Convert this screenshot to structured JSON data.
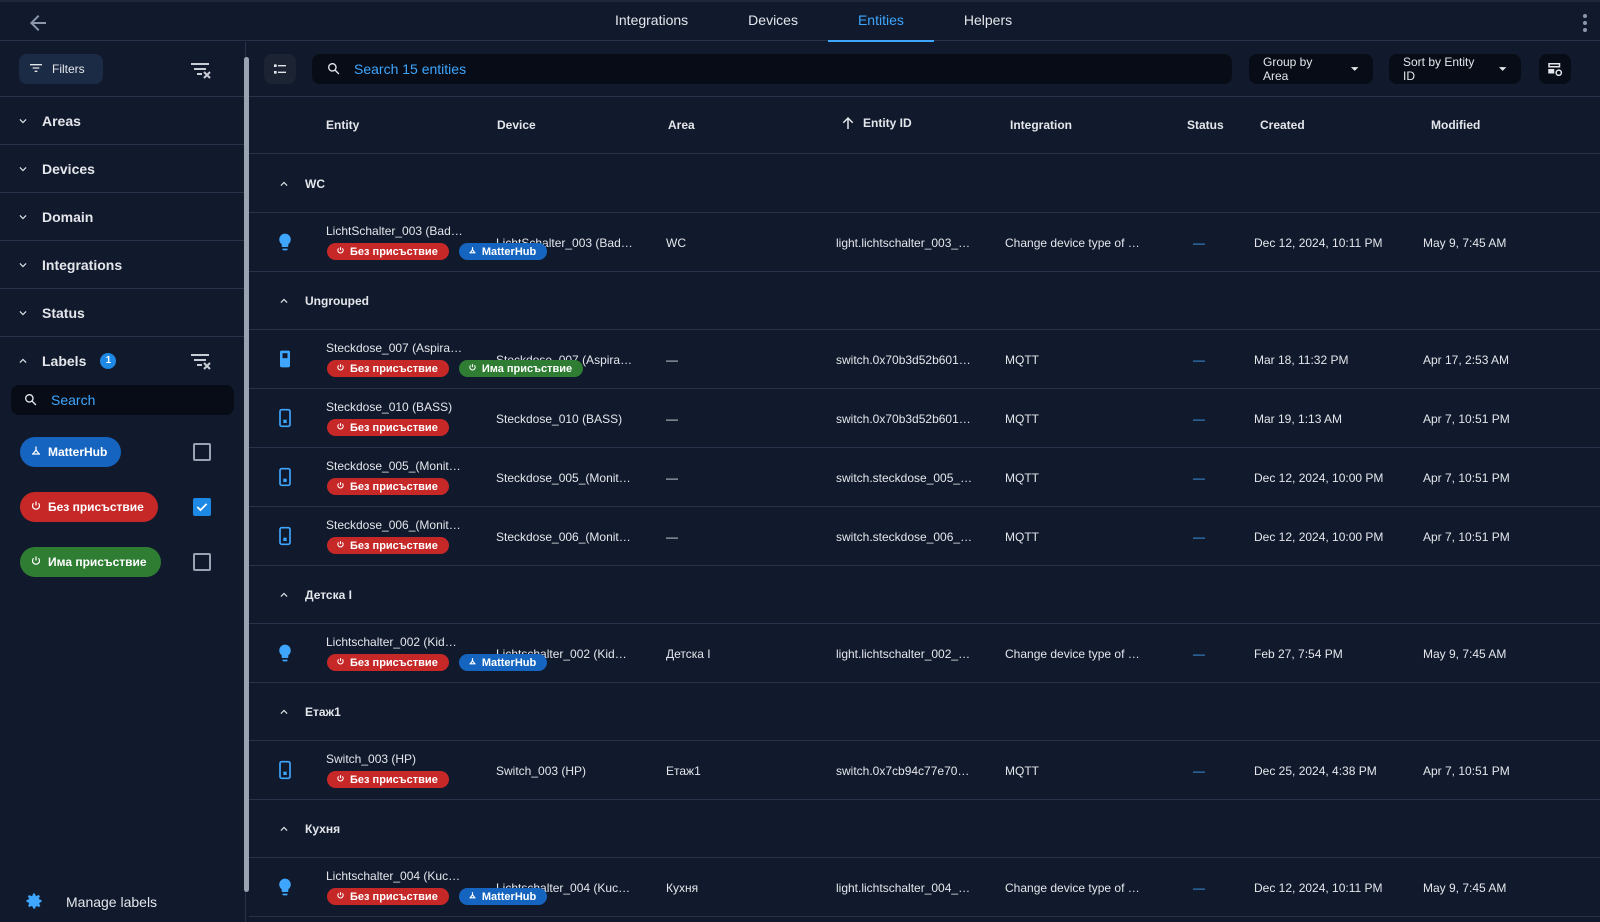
{
  "topbar": {
    "tabs": [
      {
        "label": "Integrations"
      },
      {
        "label": "Devices"
      },
      {
        "label": "Entities",
        "active": true
      },
      {
        "label": "Helpers"
      }
    ]
  },
  "sidebar": {
    "filters_label": "Filters",
    "sections": [
      {
        "label": "Areas"
      },
      {
        "label": "Devices"
      },
      {
        "label": "Domain"
      },
      {
        "label": "Integrations"
      },
      {
        "label": "Status"
      }
    ],
    "labels": {
      "title": "Labels",
      "count": "1",
      "search_placeholder": "Search",
      "items": [
        {
          "name": "MatterHub",
          "color": "#1565c0",
          "checked": false
        },
        {
          "name": "Без присъствие",
          "color": "#c62828",
          "checked": true
        },
        {
          "name": "Има присъствие",
          "color": "#2e7d32",
          "checked": false
        }
      ]
    },
    "manage_labels": "Manage labels"
  },
  "toolbar": {
    "search_placeholder": "Search 15 entities",
    "group_by": "Group by Area",
    "sort_by": "Sort by Entity ID"
  },
  "table": {
    "headers": {
      "entity": "Entity",
      "device": "Device",
      "area": "Area",
      "entity_id": "Entity ID",
      "integration": "Integration",
      "status": "Status",
      "created": "Created",
      "modified": "Modified"
    },
    "groups": [
      {
        "name": "WC",
        "rows": [
          {
            "icon": "bulb",
            "entity": "LichtSchalter_003 (Bad…",
            "chips": [
              {
                "t": "Без присъствие",
                "c": "red"
              },
              {
                "t": "MatterHub",
                "c": "blue"
              }
            ],
            "device": "LichtSchalter_003 (Bad…",
            "area": "WC",
            "entity_id": "light.lichtschalter_003_…",
            "integration": "Change device type of …",
            "status": "—",
            "created": "Dec 12, 2024, 10:11 PM",
            "modified": "May 9, 7:45 AM"
          }
        ]
      },
      {
        "name": "Ungrouped",
        "rows": [
          {
            "icon": "switch-on",
            "entity": "Steckdose_007 (Aspira…",
            "chips": [
              {
                "t": "Без присъствие",
                "c": "red"
              },
              {
                "t": "Има присъствие",
                "c": "green"
              }
            ],
            "device": "Steckdose_007 (Aspira…",
            "area": "—",
            "entity_id": "switch.0x70b3d52b601…",
            "integration": "MQTT",
            "status": "—",
            "created": "Mar 18, 11:32 PM",
            "modified": "Apr 17, 2:53 AM"
          },
          {
            "icon": "switch",
            "entity": "Steckdose_010 (BASS)",
            "chips": [
              {
                "t": "Без присъствие",
                "c": "red"
              }
            ],
            "device": "Steckdose_010 (BASS)",
            "area": "—",
            "entity_id": "switch.0x70b3d52b601…",
            "integration": "MQTT",
            "status": "—",
            "created": "Mar 19, 1:13 AM",
            "modified": "Apr 7, 10:51 PM"
          },
          {
            "icon": "switch",
            "entity": "Steckdose_005_(Monit…",
            "chips": [
              {
                "t": "Без присъствие",
                "c": "red"
              }
            ],
            "device": "Steckdose_005_(Monit…",
            "area": "—",
            "entity_id": "switch.steckdose_005_…",
            "integration": "MQTT",
            "status": "—",
            "created": "Dec 12, 2024, 10:00 PM",
            "modified": "Apr 7, 10:51 PM"
          },
          {
            "icon": "switch",
            "entity": "Steckdose_006_(Monit…",
            "chips": [
              {
                "t": "Без присъствие",
                "c": "red"
              }
            ],
            "device": "Steckdose_006_(Monit…",
            "area": "—",
            "entity_id": "switch.steckdose_006_…",
            "integration": "MQTT",
            "status": "—",
            "created": "Dec 12, 2024, 10:00 PM",
            "modified": "Apr 7, 10:51 PM"
          }
        ]
      },
      {
        "name": "Детска I",
        "rows": [
          {
            "icon": "bulb",
            "entity": "Lichtschalter_002 (Kid…",
            "chips": [
              {
                "t": "Без присъствие",
                "c": "red"
              },
              {
                "t": "MatterHub",
                "c": "blue"
              }
            ],
            "device": "Lichtschalter_002 (Kid…",
            "area": "Детска I",
            "entity_id": "light.lichtschalter_002_…",
            "integration": "Change device type of …",
            "status": "—",
            "created": "Feb 27, 7:54 PM",
            "modified": "May 9, 7:45 AM"
          }
        ]
      },
      {
        "name": "Етаж1",
        "rows": [
          {
            "icon": "switch",
            "entity": "Switch_003 (HP)",
            "chips": [
              {
                "t": "Без присъствие",
                "c": "red"
              }
            ],
            "device": "Switch_003 (HP)",
            "area": "Етаж1",
            "entity_id": "switch.0x7cb94c77e70…",
            "integration": "MQTT",
            "status": "—",
            "created": "Dec 25, 2024, 4:38 PM",
            "modified": "Apr 7, 10:51 PM"
          }
        ]
      },
      {
        "name": "Кухня",
        "rows": [
          {
            "icon": "bulb",
            "entity": "Lichtschalter_004 (Kuc…",
            "chips": [
              {
                "t": "Без присъствие",
                "c": "red"
              },
              {
                "t": "MatterHub",
                "c": "blue"
              }
            ],
            "device": "Lichtschalter_004 (Kuc…",
            "area": "Кухня",
            "entity_id": "light.lichtschalter_004_…",
            "integration": "Change device type of …",
            "status": "—",
            "created": "Dec 12, 2024, 10:11 PM",
            "modified": "May 9, 7:45 AM"
          }
        ]
      }
    ]
  }
}
